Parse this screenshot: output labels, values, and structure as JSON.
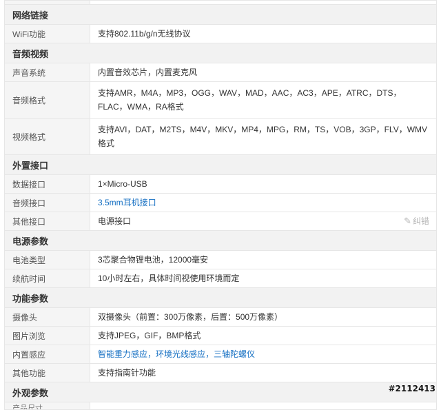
{
  "sections": [
    {
      "title": "网络链接",
      "rows": [
        {
          "label": "WiFi功能",
          "value": "支持802.11b/g/n无线协议"
        }
      ]
    },
    {
      "title": "音频视频",
      "rows": [
        {
          "label": "声音系统",
          "value": "内置音效芯片，内置麦克风"
        },
        {
          "label": "音频格式",
          "value": "支持AMR，M4A，MP3，OGG，WAV，MAD，AAC，AC3，APE，ATRC，DTS，FLAC，WMA，RA格式"
        },
        {
          "label": "视频格式",
          "value": "支持AVI，DAT，M2TS，M4V，MKV，MP4，MPG，RM，TS，VOB，3GP，FLV，WMV格式"
        }
      ]
    },
    {
      "title": "外置接口",
      "rows": [
        {
          "label": "数据接口",
          "value": "1×Micro-USB"
        },
        {
          "label": "音频接口",
          "value": "3.5mm耳机接口"
        },
        {
          "label": "其他接口",
          "value": "电源接口"
        }
      ]
    },
    {
      "title": "电源参数",
      "rows": [
        {
          "label": "电池类型",
          "value": "3芯聚合物锂电池，12000毫安"
        },
        {
          "label": "续航时间",
          "value": "10小时左右，具体时间视使用环境而定"
        }
      ]
    },
    {
      "title": "功能参数",
      "rows": [
        {
          "label": "摄像头",
          "value": "双摄像头（前置：300万像素，后置：500万像素）"
        },
        {
          "label": "图片浏览",
          "value": "支持JPEG，GIF，BMP格式"
        },
        {
          "label": "内置感应",
          "value": "智能重力感应，环境光线感应，三轴陀螺仪"
        },
        {
          "label": "其他功能",
          "value": "支持指南针功能"
        }
      ]
    },
    {
      "title": "外观参数",
      "rows": []
    }
  ],
  "edit_link": {
    "label": "纠错",
    "icon": "edit-icon"
  },
  "bottom_partial_label": "产品尺寸",
  "watermark": "#2112413",
  "colors": {
    "link": "#136ec2",
    "label_bg": "#f5f5f5",
    "section_bg": "#f2f2f2",
    "border": "#e6e6e6"
  }
}
